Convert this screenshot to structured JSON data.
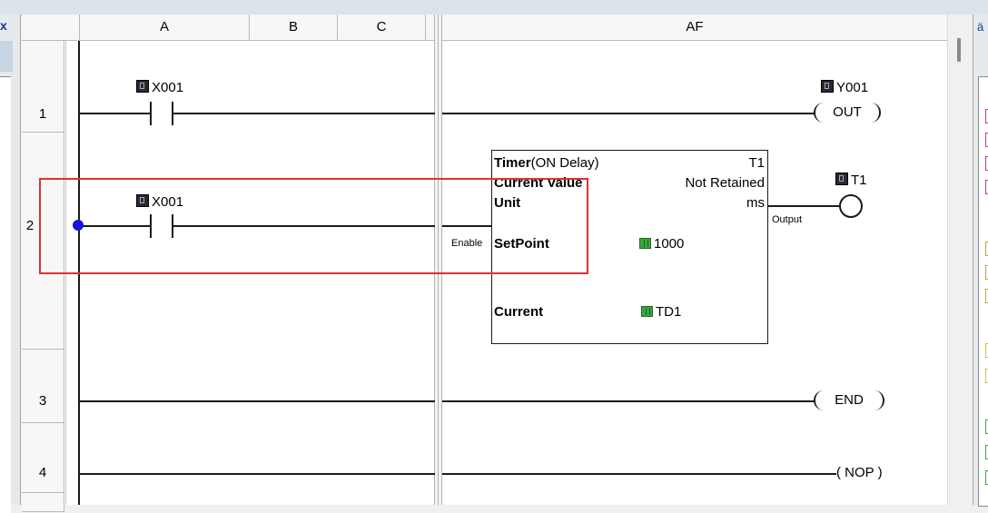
{
  "columns": [
    "A",
    "B",
    "C",
    "AF"
  ],
  "rows": [
    "1",
    "2",
    "3",
    "4"
  ],
  "rung1": {
    "contact": "X001",
    "coil_device": "Y001",
    "coil_label": "OUT"
  },
  "rung2": {
    "contact": "X001",
    "timer": {
      "title": "Timer",
      "subtitle": "(ON Delay)",
      "id": "T1",
      "current_value_label": "Current Value",
      "retain": "Not Retained",
      "unit_label": "Unit",
      "unit_value": "ms",
      "setpoint_label": "SetPoint",
      "setpoint_value": "1000",
      "current_label": "Current",
      "current_value": "TD1",
      "enable_label": "Enable",
      "output_label": "Output"
    },
    "coil_device": "T1"
  },
  "rung3": {
    "coil_label": "END"
  },
  "rung4": {
    "coil_label": "( NOP )"
  },
  "left_panel": {
    "close_glyph": "x"
  },
  "right_panel": {
    "glyph": "ä"
  },
  "colors": {
    "selection_red": "#e03131",
    "cursor_blue": "#1515e0",
    "icon_green": "#3fa43f"
  }
}
